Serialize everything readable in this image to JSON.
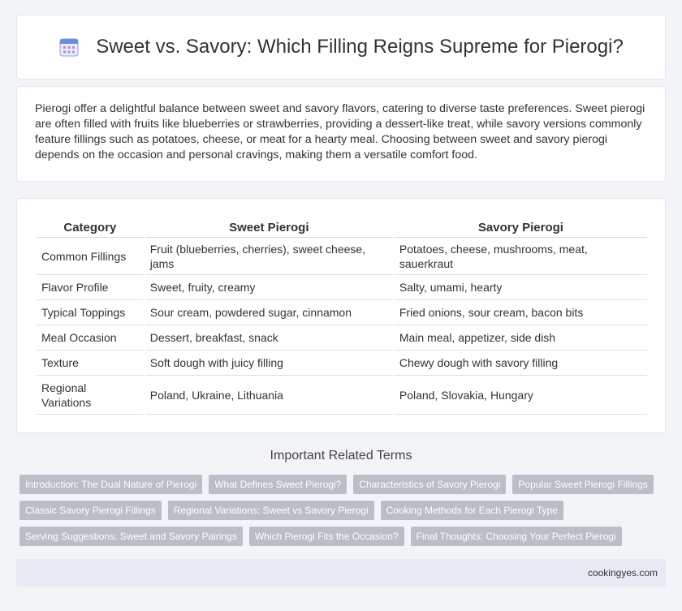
{
  "header": {
    "title": "Sweet vs. Savory: Which Filling Reigns Supreme for Pierogi?",
    "icon": "calendar-icon"
  },
  "intro": {
    "text": "Pierogi offer a delightful balance between sweet and savory flavors, catering to diverse taste preferences. Sweet pierogi are often filled with fruits like blueberries or strawberries, providing a dessert-like treat, while savory versions commonly feature fillings such as potatoes, cheese, or meat for a hearty meal. Choosing between sweet and savory pierogi depends on the occasion and personal cravings, making them a versatile comfort food."
  },
  "table": {
    "headers": [
      "Category",
      "Sweet Pierogi",
      "Savory Pierogi"
    ],
    "rows": [
      [
        "Common Fillings",
        "Fruit (blueberries, cherries), sweet cheese, jams",
        "Potatoes, cheese, mushrooms, meat, sauerkraut"
      ],
      [
        "Flavor Profile",
        "Sweet, fruity, creamy",
        "Salty, umami, hearty"
      ],
      [
        "Typical Toppings",
        "Sour cream, powdered sugar, cinnamon",
        "Fried onions, sour cream, bacon bits"
      ],
      [
        "Meal Occasion",
        "Dessert, breakfast, snack",
        "Main meal, appetizer, side dish"
      ],
      [
        "Texture",
        "Soft dough with juicy filling",
        "Chewy dough with savory filling"
      ],
      [
        "Regional Variations",
        "Poland, Ukraine, Lithuania",
        "Poland, Slovakia, Hungary"
      ]
    ]
  },
  "related": {
    "heading": "Important Related Terms",
    "tags": [
      "Introduction: The Dual Nature of Pierogi",
      "What Defines Sweet Pierogi?",
      "Characteristics of Savory Pierogi",
      "Popular Sweet Pierogi Fillings",
      "Classic Savory Pierogi Fillings",
      "Regional Variations: Sweet vs Savory Pierogi",
      "Cooking Methods for Each Pierogi Type",
      "Serving Suggestions: Sweet and Savory Pairings",
      "Which Pierogi Fits the Occasion?",
      "Final Thoughts: Choosing Your Perfect Pierogi"
    ]
  },
  "footer": {
    "site": "cookingyes.com"
  },
  "colors": {
    "tag_bg": "#b9bec7",
    "page_bg": "#f2f4f8",
    "footer_bg": "#e8ebf3",
    "icon_accent": "#6a8de0"
  }
}
